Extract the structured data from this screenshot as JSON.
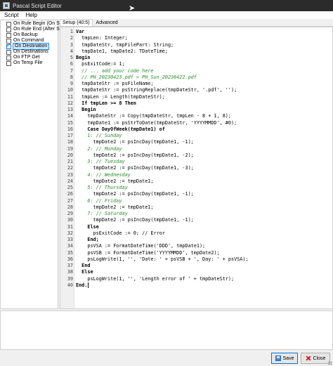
{
  "window": {
    "title": "Pascal Script Editor"
  },
  "menu": {
    "items": [
      "Script",
      "Help"
    ]
  },
  "events": [
    {
      "label": "On Rule Begin (On Scan)",
      "checked": false,
      "selected": false
    },
    {
      "label": "On Rule End (After Scan)",
      "checked": false,
      "selected": false
    },
    {
      "label": "On Backup",
      "checked": false,
      "selected": false
    },
    {
      "label": "On Command",
      "checked": false,
      "selected": false
    },
    {
      "label": "On Destination",
      "checked": true,
      "selected": true
    },
    {
      "label": "On Destinations",
      "checked": false,
      "selected": false
    },
    {
      "label": "On FTP Get",
      "checked": false,
      "selected": false
    },
    {
      "label": "On Temp File",
      "checked": false,
      "selected": false
    }
  ],
  "tabs": [
    {
      "label": "Setup (40:5)",
      "active": true
    },
    {
      "label": "Advanced",
      "active": false
    }
  ],
  "code_lines": [
    {
      "n": "1",
      "text": "Var",
      "style": "kw"
    },
    {
      "n": "2",
      "text": "  tmpLen: Integer;",
      "style": "plain"
    },
    {
      "n": "3",
      "text": "  tmpDateStr, tmpFilePart: String;",
      "style": "plain"
    },
    {
      "n": "4",
      "text": "  tmpDate1, tmpDate2: TDateTime;",
      "style": "plain"
    },
    {
      "n": "5",
      "text": "Begin",
      "style": "kw"
    },
    {
      "n": "6",
      "text": "  psExitCode:= 1;",
      "style": "plain"
    },
    {
      "n": "7",
      "text": "  // ... add your code here",
      "style": "comment"
    },
    {
      "n": "8",
      "text": "  // PH_20230423.pdf > PH_Sun_20230422.pdf",
      "style": "comment"
    },
    {
      "n": "9",
      "text": "  tmpDateStr := psFileName;",
      "style": "plain"
    },
    {
      "n": "10",
      "text": "  tmpDateStr := psStringReplace(tmpDateStr, '.pdf', '');",
      "style": "plain"
    },
    {
      "n": "11",
      "text": "  tmpLen := Length(tmpDateStr);",
      "style": "plain"
    },
    {
      "n": "12",
      "text": "  If tmpLen >= 8 Then",
      "style": "kw"
    },
    {
      "n": "13",
      "text": "  Begin",
      "style": "kw"
    },
    {
      "n": "14",
      "text": "    tmpDateStr := Copy(tmpDateStr, tmpLen - 8 + 1, 8);",
      "style": "plain"
    },
    {
      "n": "15",
      "text": "    tmpDate1 := psStrToDate(tmpDateStr, 'YYYYMMDD', #0);",
      "style": "plain"
    },
    {
      "n": "16",
      "text": "    Case DayOfWeek(tmpDate1) of",
      "style": "kw"
    },
    {
      "n": "17",
      "text": "    1: // Sunday",
      "style": "comment"
    },
    {
      "n": "18",
      "text": "      tmpDate2 := psIncDay(tmpDate1, -1);",
      "style": "plain"
    },
    {
      "n": "19",
      "text": "    2: // Monday",
      "style": "comment"
    },
    {
      "n": "20",
      "text": "      tmpDate2 := psIncDay(tmpDate1, -2);",
      "style": "plain"
    },
    {
      "n": "21",
      "text": "    3: // Tuesday",
      "style": "comment"
    },
    {
      "n": "22",
      "text": "      tmpDate2 := psIncDay(tmpDate1, -3);",
      "style": "plain"
    },
    {
      "n": "23",
      "text": "    4: // Wednesday",
      "style": "comment"
    },
    {
      "n": "24",
      "text": "      tmpDate2 := tmpDate1;",
      "style": "plain"
    },
    {
      "n": "25",
      "text": "    5: // Thursday",
      "style": "comment"
    },
    {
      "n": "26",
      "text": "      tmpDate2 := psIncDay(tmpDate1, -1);",
      "style": "plain"
    },
    {
      "n": "27",
      "text": "    6: // Friday",
      "style": "comment"
    },
    {
      "n": "28",
      "text": "      tmpDate2 := tmpDate1;",
      "style": "plain"
    },
    {
      "n": "29",
      "text": "    7: // Saturday",
      "style": "comment"
    },
    {
      "n": "30",
      "text": "      tmpDate2 := psIncDay(tmpDate1, -1);",
      "style": "plain"
    },
    {
      "n": "31",
      "text": "    Else",
      "style": "kw"
    },
    {
      "n": "32",
      "text": "      psExitCode := 0; // Error",
      "style": "plain"
    },
    {
      "n": "33",
      "text": "    End;",
      "style": "kw"
    },
    {
      "n": "34",
      "text": "    psVSA := FormatDateTime('DDD', tmpDate1);",
      "style": "plain"
    },
    {
      "n": "35",
      "text": "    psVSB := FormatDateTime('YYYYMMDD', tmpDate2);",
      "style": "plain"
    },
    {
      "n": "36",
      "text": "    psLogWrite(1, '', 'Date: ' + psVSB + ', Day: ' + psVSA);",
      "style": "plain"
    },
    {
      "n": "37",
      "text": "  End",
      "style": "kw"
    },
    {
      "n": "38",
      "text": "  Else",
      "style": "kw"
    },
    {
      "n": "39",
      "text": "    psLogWrite(1, '', 'Length error of ' + tmpDateStr);",
      "style": "plain"
    },
    {
      "n": "40",
      "text": "End.",
      "style": "kw"
    }
  ],
  "buttons": {
    "save": "Save",
    "close": "Close"
  },
  "colors": {
    "comment": "#2a8c2a",
    "selection": "#cce8ff",
    "accent": "#0078d7"
  }
}
